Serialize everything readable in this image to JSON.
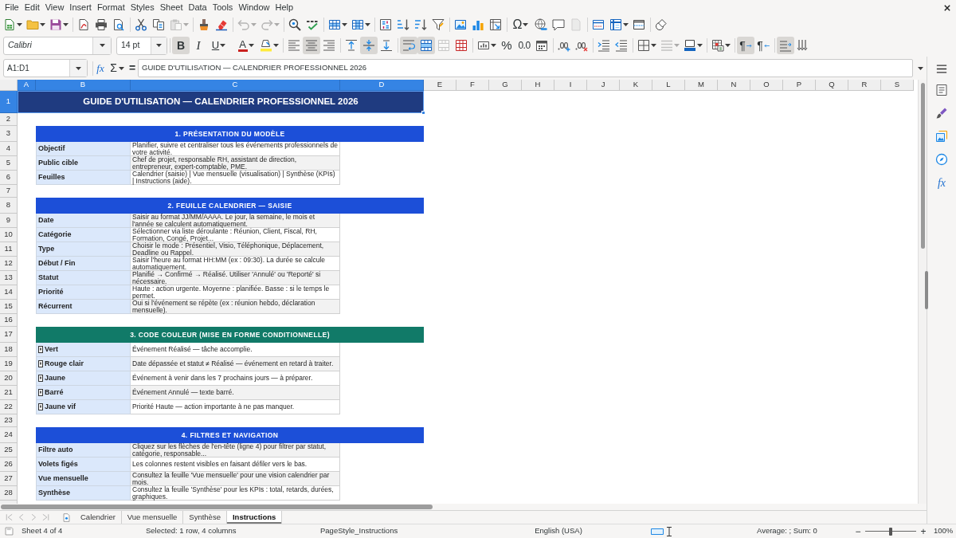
{
  "menu_bar": [
    "File",
    "Edit",
    "View",
    "Insert",
    "Format",
    "Styles",
    "Sheet",
    "Data",
    "Tools",
    "Window",
    "Help"
  ],
  "standard_toolbar": {
    "paste": {
      "disabled": true
    },
    "undo": {
      "disabled": true
    },
    "redo": {
      "disabled": true
    },
    "special_character": "Ω",
    "header_footer": {
      "disabled": true
    }
  },
  "formatting_toolbar": {
    "font_name": "Calibri",
    "font_size": "14 pt",
    "bold": {
      "symbol": "B",
      "on": true
    },
    "italic": {
      "symbol": "I",
      "on": false
    },
    "underline": {
      "symbol": "U",
      "on": false
    },
    "font_color": "A",
    "align_left": {
      "on": false
    },
    "align_center": {
      "on": true
    },
    "align_right": {
      "on": false
    },
    "align_top": {
      "on": false
    },
    "align_middle": {
      "on": true
    },
    "align_bottom": {
      "on": false
    },
    "wrap_text": {
      "on": true
    },
    "merge_and_center": {
      "on": true
    },
    "merge_cells": {
      "disabled": true
    },
    "percent": "%",
    "number": "0.0",
    "border_style": {
      "disabled": true
    },
    "left_to_right": {
      "symbol": "¶",
      "on": true
    },
    "right_to_left": {
      "symbol": "¶",
      "on": false
    },
    "text_ltr": {
      "on": true
    },
    "text_ttb": {
      "on": false
    }
  },
  "formula_bar": {
    "name_box": "A1:D1",
    "function_wizard": "fx",
    "sum": "Σ",
    "formula": "=",
    "content": "GUIDE D'UTILISATION — CALENDRIER PROFESSIONNEL 2026"
  },
  "sidebar": {
    "functions": "fx"
  },
  "sheet": {
    "columns": [
      {
        "label": "A",
        "selected": true
      },
      {
        "label": "B",
        "selected": true
      },
      {
        "label": "C",
        "selected": true
      },
      {
        "label": "D",
        "selected": true
      },
      {
        "label": "E",
        "selected": false
      },
      {
        "label": "F",
        "selected": false
      },
      {
        "label": "G",
        "selected": false
      },
      {
        "label": "H",
        "selected": false
      },
      {
        "label": "I",
        "selected": false
      },
      {
        "label": "J",
        "selected": false
      },
      {
        "label": "K",
        "selected": false
      },
      {
        "label": "L",
        "selected": false
      },
      {
        "label": "M",
        "selected": false
      },
      {
        "label": "N",
        "selected": false
      },
      {
        "label": "O",
        "selected": false
      },
      {
        "label": "P",
        "selected": false
      },
      {
        "label": "Q",
        "selected": false
      },
      {
        "label": "R",
        "selected": false
      },
      {
        "label": "S",
        "selected": false
      }
    ],
    "rows": [
      {
        "label": "1",
        "selected": true
      },
      {
        "label": "2",
        "selected": false
      },
      {
        "label": "3",
        "selected": false
      },
      {
        "label": "4",
        "selected": false
      },
      {
        "label": "5",
        "selected": false
      },
      {
        "label": "6",
        "selected": false
      },
      {
        "label": "7",
        "selected": false
      },
      {
        "label": "8",
        "selected": false
      },
      {
        "label": "9",
        "selected": false
      },
      {
        "label": "10",
        "selected": false
      },
      {
        "label": "11",
        "selected": false
      },
      {
        "label": "12",
        "selected": false
      },
      {
        "label": "13",
        "selected": false
      },
      {
        "label": "14",
        "selected": false
      },
      {
        "label": "15",
        "selected": false
      },
      {
        "label": "16",
        "selected": false
      },
      {
        "label": "17",
        "selected": false
      },
      {
        "label": "18",
        "selected": false
      },
      {
        "label": "19",
        "selected": false
      },
      {
        "label": "20",
        "selected": false
      },
      {
        "label": "21",
        "selected": false
      },
      {
        "label": "22",
        "selected": false
      },
      {
        "label": "23",
        "selected": false
      },
      {
        "label": "24",
        "selected": false
      },
      {
        "label": "25",
        "selected": false
      },
      {
        "label": "26",
        "selected": false
      },
      {
        "label": "27",
        "selected": false
      },
      {
        "label": "28",
        "selected": false
      }
    ],
    "title": {
      "text": "GUIDE D'UTILISATION — CALENDRIER PROFESSIONNEL 2026",
      "selected": true
    },
    "sections": [
      {
        "heading": "1. PRÉSENTATION DU MODÈLE",
        "color": "#1c4fd8",
        "marker": false,
        "entries": [
          {
            "label": "Objectif",
            "text": "Planifier, suivre et centraliser tous les événements professionnels de votre activité."
          },
          {
            "label": "Public cible",
            "text": "Chef de projet, responsable RH, assistant de direction, entrepreneur, expert-comptable, PME."
          },
          {
            "label": "Feuilles",
            "text": "Calendrier (saisie) | Vue mensuelle (visualisation) | Synthèse (KPIs) | Instructions (aide)."
          }
        ]
      },
      {
        "heading": "2. FEUILLE CALENDRIER — SAISIE",
        "color": "#1c4fd8",
        "marker": false,
        "entries": [
          {
            "label": "Date",
            "text": "Saisir au format JJ/MM/AAAA. Le jour, la semaine, le mois et l'année se calculent automatiquement."
          },
          {
            "label": "Catégorie",
            "text": "Sélectionner via liste déroulante : Réunion, Client, Fiscal, RH, Formation, Congé, Projet..."
          },
          {
            "label": "Type",
            "text": "Choisir le mode : Présentiel, Visio, Téléphonique, Déplacement, Deadline ou Rappel."
          },
          {
            "label": "Début / Fin",
            "text": "Saisir l'heure au format HH:MM (ex : 09:30). La durée se calcule automatiquement."
          },
          {
            "label": "Statut",
            "text": "Planifié → Confirmé → Réalisé. Utiliser 'Annulé' ou 'Reporté' si nécessaire."
          },
          {
            "label": "Priorité",
            "text": "Haute : action urgente. Moyenne : planifiée. Basse : si le temps le permet."
          },
          {
            "label": "Récurrent",
            "text": "Oui si l'événement se répète (ex : réunion hebdo, déclaration mensuelle)."
          }
        ]
      },
      {
        "heading": "3. CODE COULEUR (MISE EN FORME CONDITIONNELLE)",
        "color": "#117a68",
        "marker": true,
        "entries": [
          {
            "label": "Vert",
            "text": "Événement Réalisé — tâche accomplie."
          },
          {
            "label": "Rouge clair",
            "text": "Date dépassée et statut ≠ Réalisé — événement en retard à traiter."
          },
          {
            "label": "Jaune",
            "text": "Événement à venir dans les 7 prochains jours — à préparer."
          },
          {
            "label": "Barré",
            "text": "Événement Annulé — texte barré."
          },
          {
            "label": "Jaune vif",
            "text": "Priorité Haute — action importante à ne pas manquer."
          }
        ]
      },
      {
        "heading": "4. FILTRES ET NAVIGATION",
        "color": "#1c4fd8",
        "marker": false,
        "entries": [
          {
            "label": "Filtre auto",
            "text": "Cliquez sur les flèches de l'en-tête (ligne 4) pour filtrer par statut, catégorie, responsable..."
          },
          {
            "label": "Volets figés",
            "text": "Les colonnes restent visibles en faisant défiler vers le bas."
          },
          {
            "label": "Vue mensuelle",
            "text": "Consultez la feuille 'Vue mensuelle' pour une vision calendrier par mois."
          },
          {
            "label": "Synthèse",
            "text": "Consultez la feuille 'Synthèse' pour les KPIs : total, retards, durées, graphiques."
          }
        ]
      }
    ]
  },
  "sheet_tabs": {
    "navigation_disabled": true,
    "tabs": [
      {
        "label": "Calendrier",
        "selected": false
      },
      {
        "label": "Vue mensuelle",
        "selected": false
      },
      {
        "label": "Synthèse",
        "selected": false
      },
      {
        "label": "Instructions",
        "selected": true
      }
    ]
  },
  "status_bar": {
    "sheet_position": "Sheet 4 of 4",
    "selection": "Selected: 1 row, 4 columns",
    "page_style": "PageStyle_Instructions",
    "language": "English (USA)",
    "summary": "Average: ; Sum: 0",
    "zoom_out": "−",
    "zoom_slider": {
      "level": 0.5
    },
    "zoom_in": "+",
    "zoom": "100%"
  }
}
